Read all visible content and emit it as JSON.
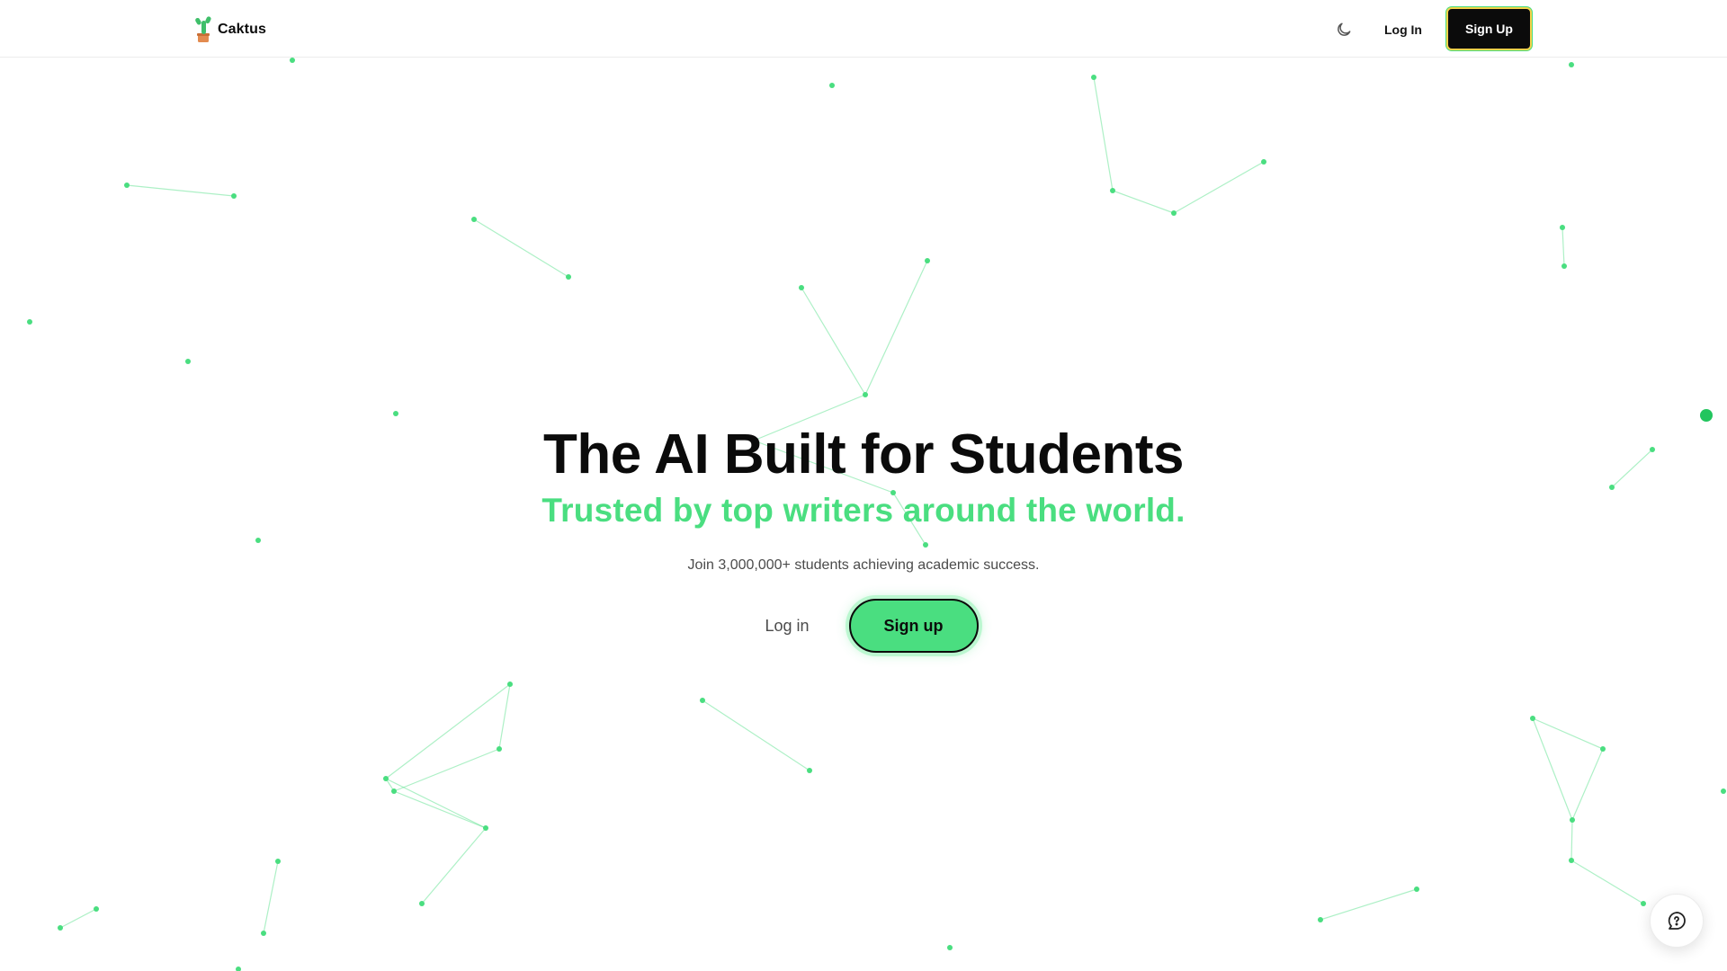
{
  "navbar": {
    "brand_name": "Caktus",
    "brand_icon": "cactus-logo-icon",
    "theme_icon": "moon-icon",
    "login_label": "Log In",
    "signup_label": "Sign Up"
  },
  "hero": {
    "title": "The AI Built for Students",
    "subtitle": "Trusted by top writers around the world.",
    "description": "Join 3,000,000+ students achieving academic success.",
    "login_label": "Log in",
    "signup_label": "Sign up"
  },
  "help": {
    "icon": "chat-help-icon"
  },
  "colors": {
    "accent": "#4ade80",
    "accent_strong": "#22c55e",
    "text": "#0b0b0b",
    "muted": "#4b4b4b",
    "button_dark": "#0b0b0b",
    "button_border_highlight": "#f5d24b"
  }
}
